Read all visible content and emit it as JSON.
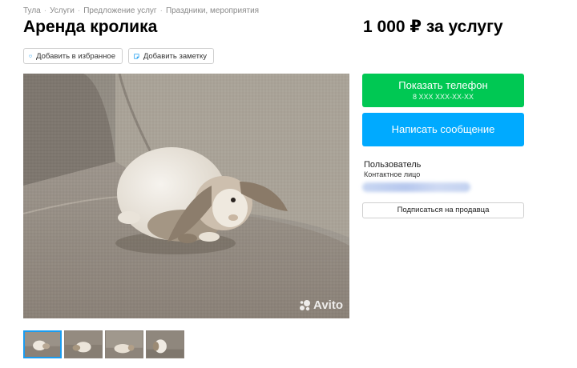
{
  "breadcrumbs": [
    "Тула",
    "Услуги",
    "Предложение услуг",
    "Праздники, мероприятия"
  ],
  "title": "Аренда кролика",
  "price": "1 000 ₽ за услугу",
  "actions": {
    "favorite_label": "Добавить в избранное",
    "note_label": "Добавить заметку"
  },
  "gallery": {
    "watermark": "Avito",
    "thumbnail_count": 4
  },
  "contact": {
    "phone_button_label": "Показать телефон",
    "phone_masked": "8 XXX XXX-XX-XX",
    "message_button_label": "Написать сообщение"
  },
  "seller": {
    "name": "Пользователь",
    "role": "Контактное лицо",
    "subscribe_label": "Подписаться на продавца"
  },
  "colors": {
    "phone_button": "#00c853",
    "message_button": "#00aaff",
    "active_thumb_border": "#1a9cf0"
  }
}
